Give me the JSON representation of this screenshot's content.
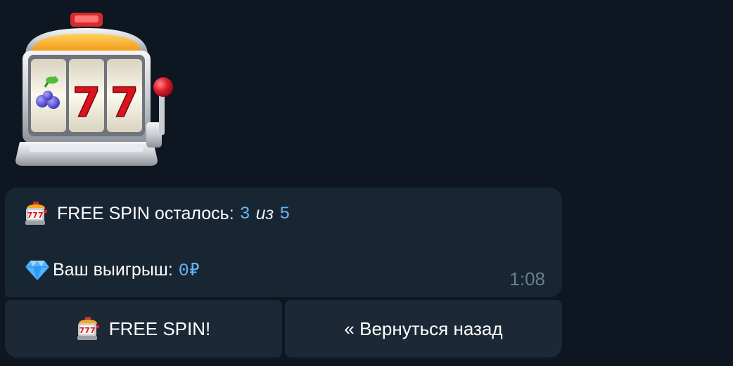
{
  "sticker": {
    "icon": "slot-machine-icon"
  },
  "message": {
    "line1_label": "FREE SPIN осталось:",
    "spins_left": "3",
    "of_word": "из",
    "spins_total": "5",
    "line2_label": "Ваш выигрыш:",
    "winnings": "0₽",
    "time": "1:08"
  },
  "keyboard": {
    "free_spin_label": "FREE SPIN!",
    "back_label": "« Вернуться назад"
  },
  "colors": {
    "background": "#0e1621",
    "bubble": "#182533",
    "button": "#1c2835",
    "accent": "#6ab3f3",
    "timestamp": "#6d7f8f"
  }
}
